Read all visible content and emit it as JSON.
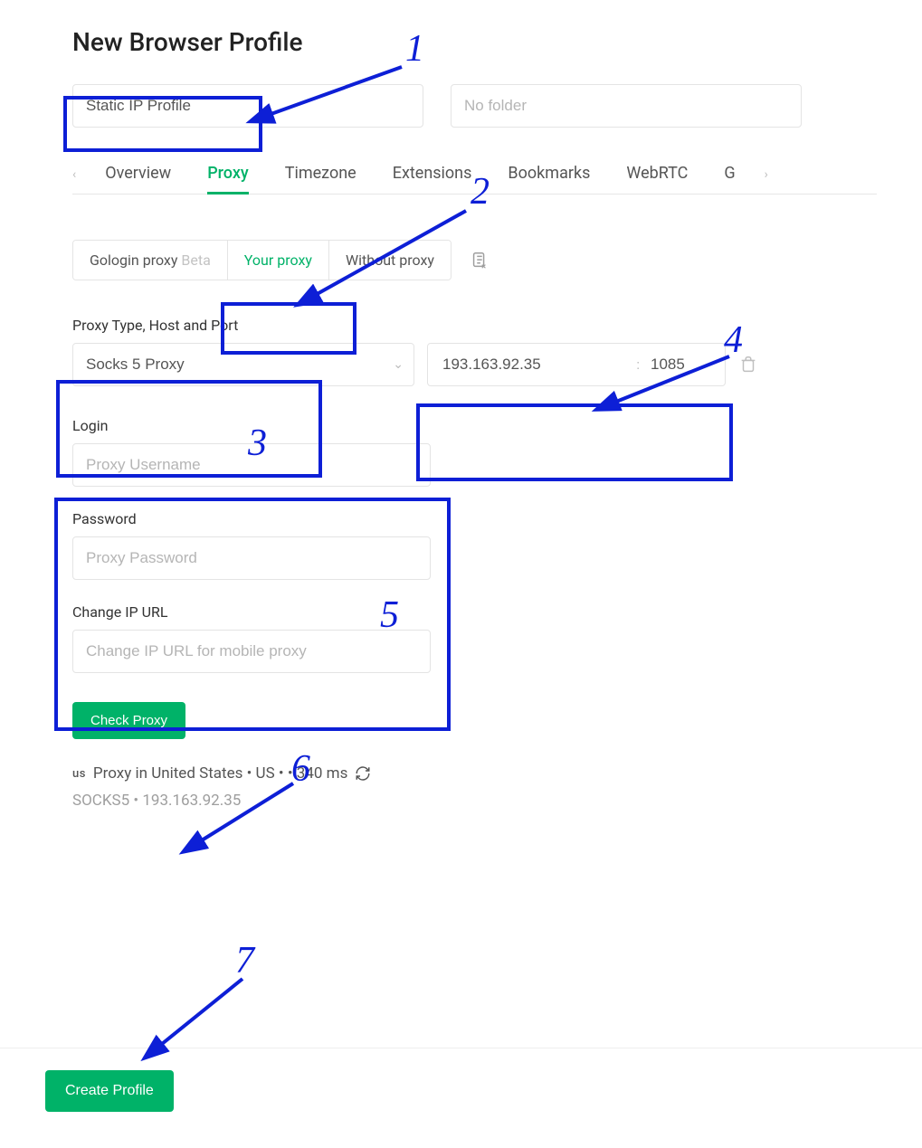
{
  "page_title": "New Browser Profile",
  "profile_name_value": "Static IP Profile",
  "folder_placeholder": "No folder",
  "tabs": {
    "items": [
      "Overview",
      "Proxy",
      "Timezone",
      "Extensions",
      "Bookmarks",
      "WebRTC",
      "G"
    ],
    "active_index": 1
  },
  "proxy_modes": {
    "gologin_label": "Gologin proxy",
    "gologin_suffix": "Beta",
    "your_label": "Your proxy",
    "without_label": "Without proxy",
    "active": "your"
  },
  "proxy_type": {
    "label": "Proxy Type, Host and Port",
    "value": "Socks 5 Proxy",
    "host": "193.163.92.35",
    "port": "1085"
  },
  "login": {
    "label": "Login",
    "placeholder": "Proxy Username",
    "value": ""
  },
  "password": {
    "label": "Password",
    "placeholder": "Proxy Password",
    "value": ""
  },
  "change_ip": {
    "label": "Change IP URL",
    "placeholder": "Change IP URL for mobile proxy",
    "value": ""
  },
  "check_proxy_label": "Check Proxy",
  "status": {
    "flag": "us",
    "line1": "Proxy in United States • US • • 340 ms",
    "line2": "SOCKS5 • 193.163.92.35"
  },
  "create_profile_label": "Create Profile",
  "annotations": [
    "1",
    "2",
    "3",
    "4",
    "5",
    "6",
    "7"
  ]
}
